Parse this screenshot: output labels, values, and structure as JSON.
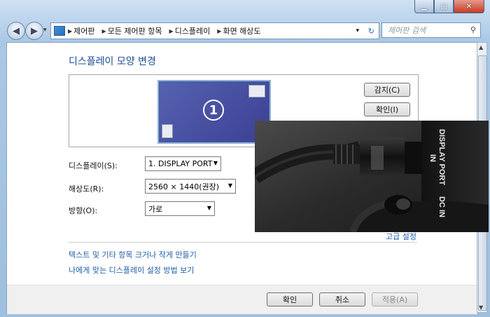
{
  "window": {
    "minimize": "▁",
    "maximize": "□",
    "close": "✕"
  },
  "nav": {
    "back": "◀",
    "forward": "▶",
    "history": "▾",
    "breadcrumb": [
      "제어판",
      "모든 제어판 항목",
      "디스플레이",
      "화면 해상도"
    ],
    "refresh": "↻",
    "search_placeholder": "제어판 검색",
    "search_icon": "🔍"
  },
  "page": {
    "title": "디스플레이 모양 변경",
    "monitor_number": "1",
    "detect_button": "감지(C)",
    "identify_button": "확인(I)",
    "display_label": "디스플레이(S):",
    "display_value": "1. DISPLAY PORT",
    "resolution_label": "해상도(R):",
    "resolution_value": "2560 × 1440(권장)",
    "orientation_label": "방향(O):",
    "orientation_value": "가로",
    "advanced_link": "고급 설정",
    "text_size_link": "텍스트 및 기타 항목 크거나 작게 만들기",
    "help_link": "나에게 맞는 디스플레이 설정 방법 보기",
    "ok_button": "확인",
    "cancel_button": "취소",
    "apply_button": "적용(A)"
  },
  "photo": {
    "label_1": "DISPLAY PORT",
    "label_2": "IN",
    "label_3": "DC IN"
  }
}
